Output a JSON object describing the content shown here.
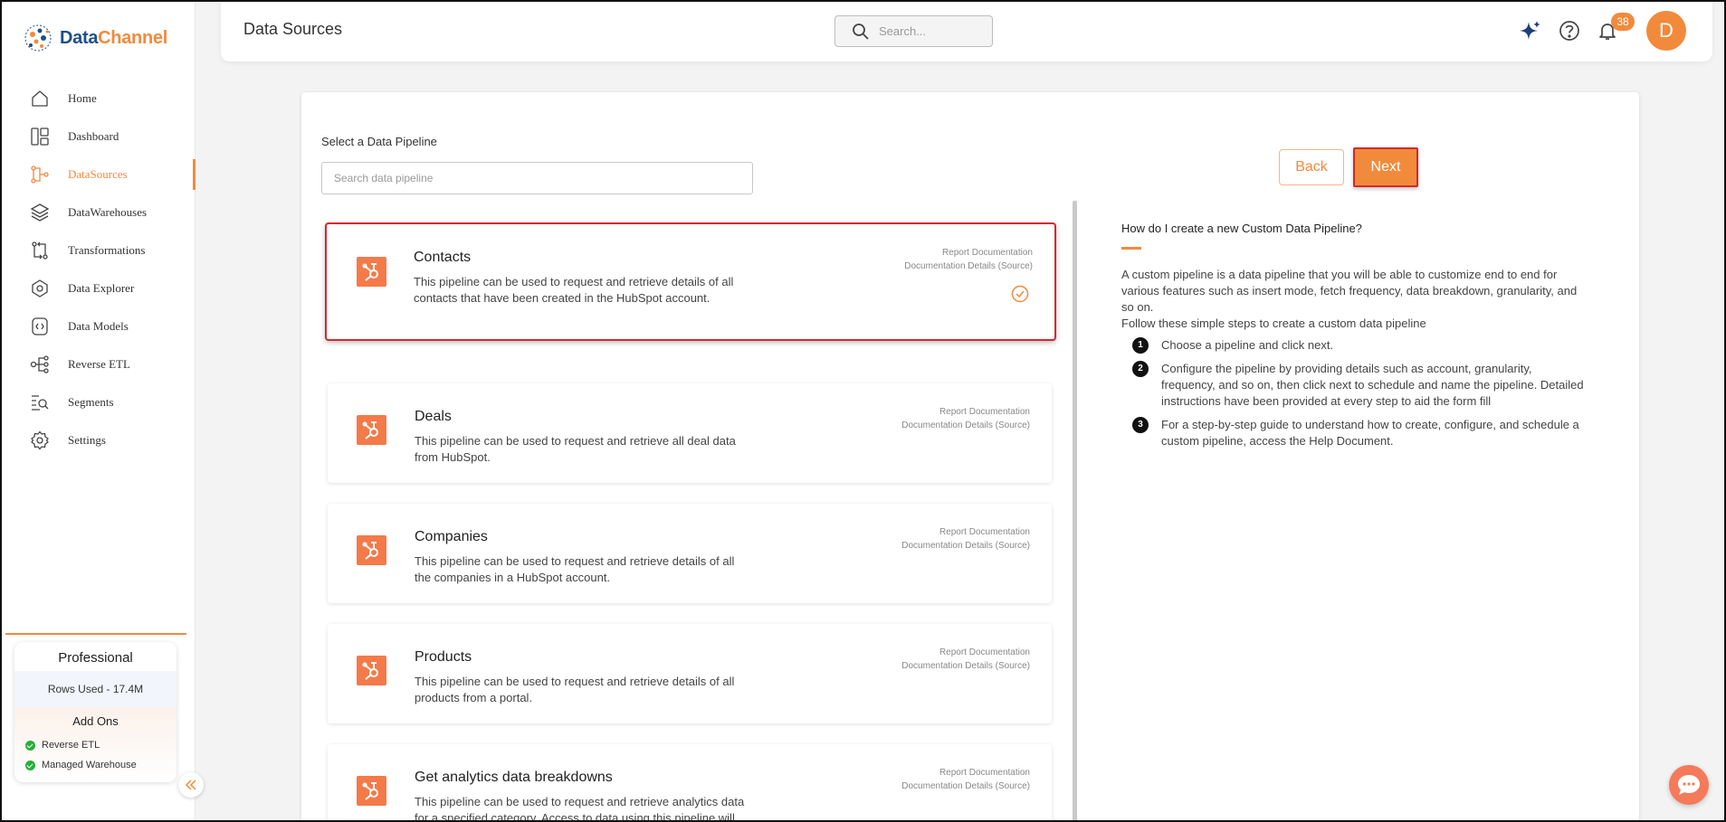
{
  "brand": {
    "part1": "Data",
    "part2": "Channel",
    "color_primary": "#1d4f8c",
    "color_accent": "#f28a3c"
  },
  "sidebar": {
    "items": [
      {
        "label": "Home",
        "icon": "home-icon"
      },
      {
        "label": "Dashboard",
        "icon": "dashboard-icon"
      },
      {
        "label": "DataSources",
        "icon": "datasources-icon",
        "active": true
      },
      {
        "label": "DataWarehouses",
        "icon": "layers-icon"
      },
      {
        "label": "Transformations",
        "icon": "transform-icon"
      },
      {
        "label": "Data Explorer",
        "icon": "explorer-icon"
      },
      {
        "label": "Data Models",
        "icon": "models-icon"
      },
      {
        "label": "Reverse ETL",
        "icon": "reverse-etl-icon"
      },
      {
        "label": "Segments",
        "icon": "segments-icon"
      },
      {
        "label": "Settings",
        "icon": "gear-icon"
      }
    ],
    "plan": {
      "title": "Professional",
      "rows_used": "Rows Used - 17.4M",
      "addons_title": "Add Ons",
      "addons": [
        "Reverse ETL",
        "Managed Warehouse"
      ]
    }
  },
  "header": {
    "title": "Data Sources",
    "search_placeholder": "Search...",
    "notification_count": "38",
    "avatar_initial": "D"
  },
  "main": {
    "select_label": "Select a Data Pipeline",
    "search_placeholder": "Search data pipeline",
    "back_label": "Back",
    "next_label": "Next",
    "pipelines": [
      {
        "name": "Contacts",
        "description": "This pipeline can be used to request and retrieve details of all contacts that have been created in the HubSpot account.",
        "link1": "Report Documentation",
        "link2": "Documentation Details (Source)",
        "selected": true
      },
      {
        "name": "Deals",
        "description": "This pipeline can be used to request and retrieve all deal data from HubSpot.",
        "link1": "Report Documentation",
        "link2": "Documentation Details (Source)"
      },
      {
        "name": "Companies",
        "description": "This pipeline can be used to request and retrieve details of all the companies in a HubSpot account.",
        "link1": "Report Documentation",
        "link2": "Documentation Details (Source)"
      },
      {
        "name": "Products",
        "description": "This pipeline can be used to request and retrieve details of all products from a portal.",
        "link1": "Report Documentation",
        "link2": "Documentation Details (Source)"
      },
      {
        "name": "Get analytics data breakdowns",
        "description": "This pipeline can be used to request and retrieve analytics data for a specified category. Access to data using this pipeline will depend on the connected HubSpot account's",
        "link1": "Report Documentation",
        "link2": "Documentation Details (Source)"
      }
    ],
    "help": {
      "question": "How do I create a new Custom Data Pipeline?",
      "paragraph1": "A custom pipeline is a data pipeline that you will be able to customize end to end for various features such as insert mode, fetch frequency, data breakdown, granularity, and so on.",
      "paragraph2": "Follow these simple steps to create a custom data pipeline",
      "steps": [
        {
          "num": "1",
          "text": "Choose a pipeline and click next."
        },
        {
          "num": "2",
          "text": "Configure the pipeline by providing details such as account, granularity, frequency, and so on, then click next to schedule and name the pipeline. Detailed instructions have been provided at every step to aid the form fill"
        },
        {
          "num": "3",
          "text": "For a step-by-step guide to understand how to create, configure, and schedule a custom pipeline, access the Help Document."
        }
      ]
    }
  }
}
